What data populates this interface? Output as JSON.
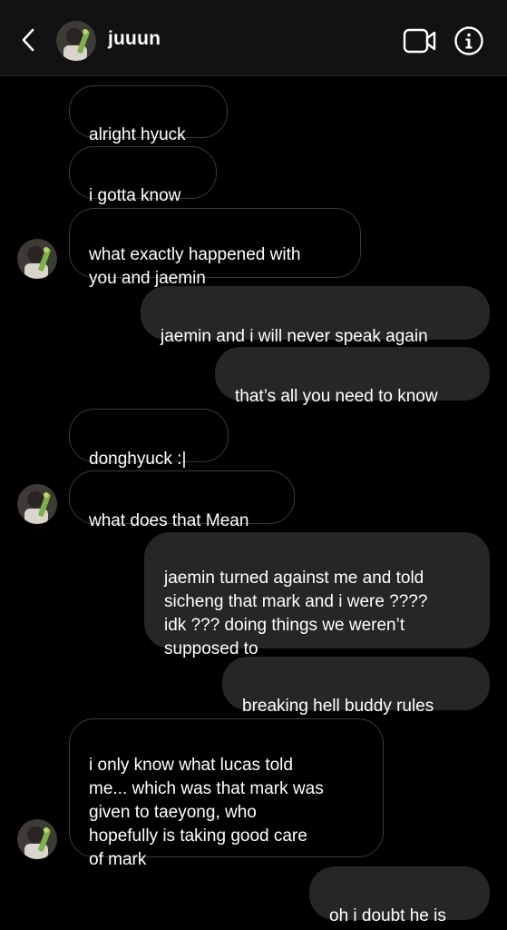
{
  "header": {
    "back_icon": "chevron-left-icon",
    "username": "juuun",
    "video_icon": "video-camera-icon",
    "info_icon": "info-icon"
  },
  "messages": [
    {
      "from": "them",
      "text": "alright hyuck"
    },
    {
      "from": "them",
      "text": "i gotta know"
    },
    {
      "from": "them",
      "text": "what exactly happened with\nyou and jaemin"
    },
    {
      "from": "me",
      "text": "jaemin and i will never speak again"
    },
    {
      "from": "me",
      "text": "that’s all you need to know"
    },
    {
      "from": "them",
      "text": "donghyuck :|"
    },
    {
      "from": "them",
      "text": "what does that Mean"
    },
    {
      "from": "me",
      "text": "jaemin turned against me and told\nsicheng that mark and i were ????\nidk ??? doing things we weren’t\nsupposed to"
    },
    {
      "from": "me",
      "text": "breaking hell buddy rules"
    },
    {
      "from": "them",
      "text": "i only know what lucas told\nme... which was that mark was\ngiven to taeyong, who\nhopefully is taking good care\nof mark"
    },
    {
      "from": "me",
      "text": "oh i doubt he is"
    }
  ],
  "colors": {
    "background": "#000000",
    "header": "#121212",
    "outgoing_bubble": "#262626",
    "incoming_border": "#3a3a3a",
    "text": "#ffffff"
  }
}
